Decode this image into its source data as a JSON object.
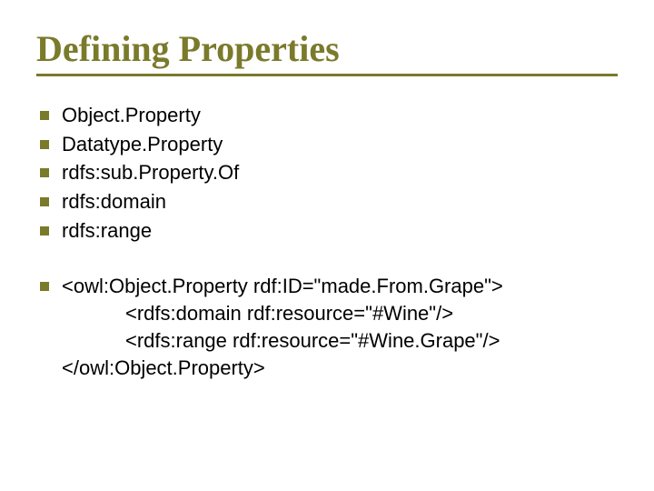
{
  "title": "Defining Properties",
  "items": [
    "Object.Property",
    "Datatype.Property",
    "rdfs:sub.Property.Of",
    "rdfs:domain",
    "rdfs:range"
  ],
  "code": {
    "line1": "<owl:Object.Property rdf:ID=\"made.From.Grape\">",
    "line2": "<rdfs:domain rdf:resource=\"#Wine\"/>",
    "line3": "<rdfs:range rdf:resource=\"#Wine.Grape\"/>",
    "line4": "</owl:Object.Property>"
  }
}
